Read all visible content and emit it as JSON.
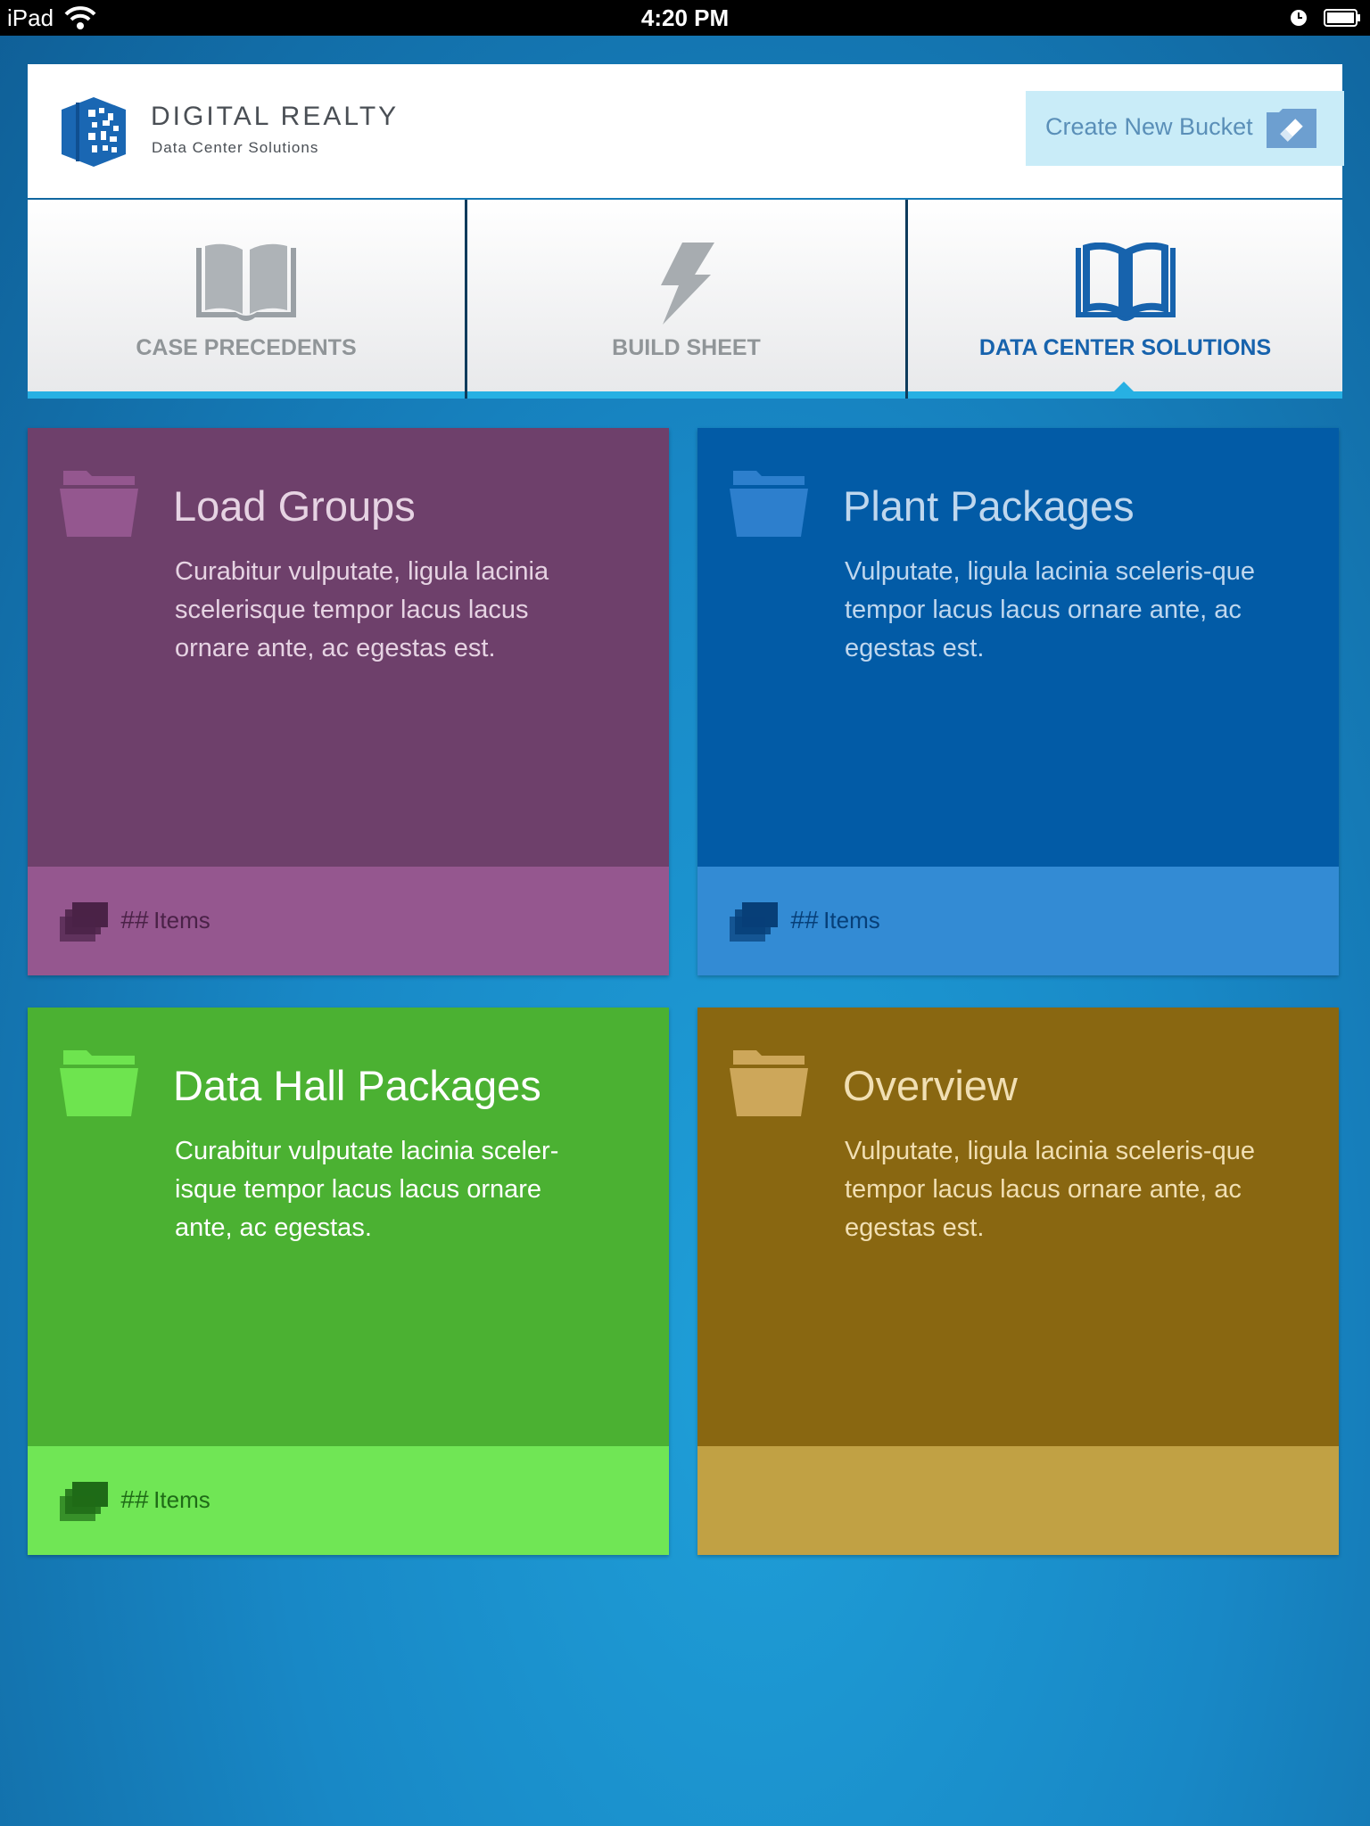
{
  "status_bar": {
    "device": "iPad",
    "time": "4:20 PM"
  },
  "header": {
    "brand_name": "DIGITAL REALTY",
    "brand_subtitle": "Data Center Solutions",
    "create_button_label": "Create New Bucket"
  },
  "tabs": [
    {
      "label": "CASE PRECEDENTS",
      "icon": "book-icon",
      "active": false
    },
    {
      "label": "BUILD SHEET",
      "icon": "lightning-icon",
      "active": false
    },
    {
      "label": "DATA CENTER SOLUTIONS",
      "icon": "open-book-icon",
      "active": true
    }
  ],
  "tiles": [
    {
      "title": "Load Groups",
      "description": "Curabitur vulputate, ligula lacinia scelerisque tempor lacus lacus ornare ante, ac egestas est.",
      "count_prefix": "##",
      "count_label": "Items",
      "colors": {
        "body": "#6e406b",
        "footer": "#95578f",
        "folder": "#94578f",
        "text": "#e6d3e3",
        "icon": "#4a2247"
      }
    },
    {
      "title": "Plant Packages",
      "description": "Vulputate, ligula lacinia sceleris-que tempor lacus lacus ornare ante, ac egestas est.",
      "count_prefix": "##",
      "count_label": "Items",
      "colors": {
        "body": "#025ba6",
        "footer": "#338bd4",
        "folder": "#2d7fcd",
        "text": "#bfd7ee",
        "icon": "#073f78"
      }
    },
    {
      "title": "Data Hall Packages",
      "description": "Curabitur vulputate lacinia sceler-isque tempor lacus lacus ornare ante, ac egestas.",
      "count_prefix": "##",
      "count_label": "Items",
      "colors": {
        "body": "#4bb132",
        "footer": "#70e655",
        "folder": "#6ee44f",
        "text": "#ffffff",
        "icon": "#1f6b17"
      }
    },
    {
      "title": "Overview",
      "description": "Vulputate, ligula lacinia sceleris-que tempor lacus lacus ornare ante, ac egestas est.",
      "count_prefix": "",
      "count_label": "",
      "colors": {
        "body": "#896711",
        "footer": "#c1a144",
        "folder": "#cda75a",
        "text": "#f1dfb3",
        "icon": "#6b500c"
      }
    }
  ]
}
